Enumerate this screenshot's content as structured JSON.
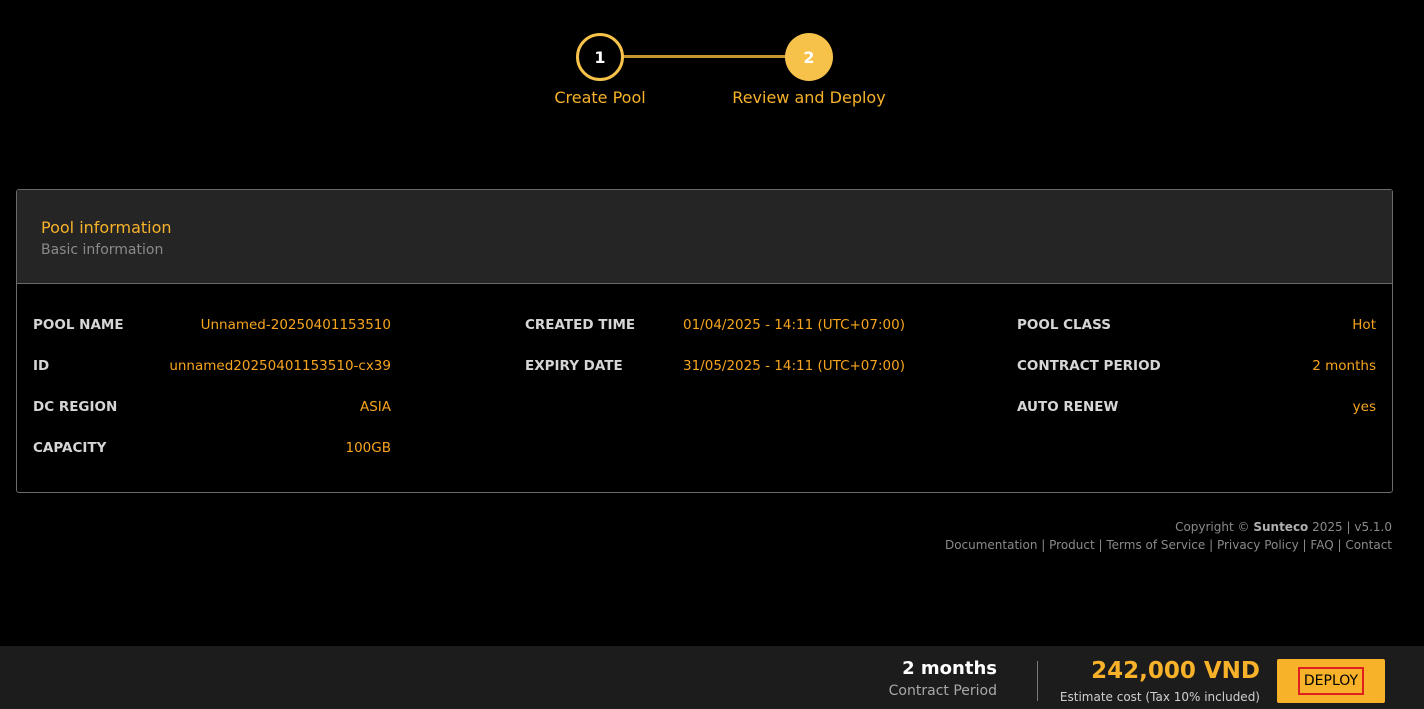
{
  "stepper": {
    "steps": [
      {
        "number": "1",
        "label": "Create Pool"
      },
      {
        "number": "2",
        "label": "Review and Deploy"
      }
    ]
  },
  "card": {
    "title": "Pool information",
    "subtitle": "Basic information",
    "col1": [
      {
        "key": "POOL NAME",
        "value": "Unnamed-20250401153510"
      },
      {
        "key": "ID",
        "value": "unnamed20250401153510-cx39"
      },
      {
        "key": "DC REGION",
        "value": "ASIA"
      },
      {
        "key": "CAPACITY",
        "value": "100GB"
      }
    ],
    "col2": [
      {
        "key": "CREATED TIME",
        "value": "01/04/2025 - 14:11 (UTC+07:00)"
      },
      {
        "key": "EXPIRY DATE",
        "value": "31/05/2025 - 14:11 (UTC+07:00)"
      }
    ],
    "col3": [
      {
        "key": "POOL CLASS",
        "value": "Hot"
      },
      {
        "key": "CONTRACT PERIOD",
        "value": "2 months"
      },
      {
        "key": "AUTO RENEW",
        "value": "yes"
      }
    ]
  },
  "footer": {
    "copyright_prefix": "Copyright ©",
    "brand": "Sunteco",
    "copyright_suffix": "2025 | v5.1.0",
    "links": [
      "Documentation",
      "Product",
      "Terms of Service",
      "Privacy Policy",
      "FAQ",
      "Contact"
    ],
    "separator": " | "
  },
  "bottom_bar": {
    "period_value": "2 months",
    "period_label": "Contract Period",
    "cost_value": "242,000 VND",
    "cost_label": "Estimate cost (Tax 10% included)",
    "deploy_label": "DEPLOY"
  },
  "colors": {
    "accent": "#f7b22a",
    "value_text": "#f7a51f",
    "card_header_bg": "#252525",
    "bottom_bar_bg": "#1c1c1c"
  }
}
